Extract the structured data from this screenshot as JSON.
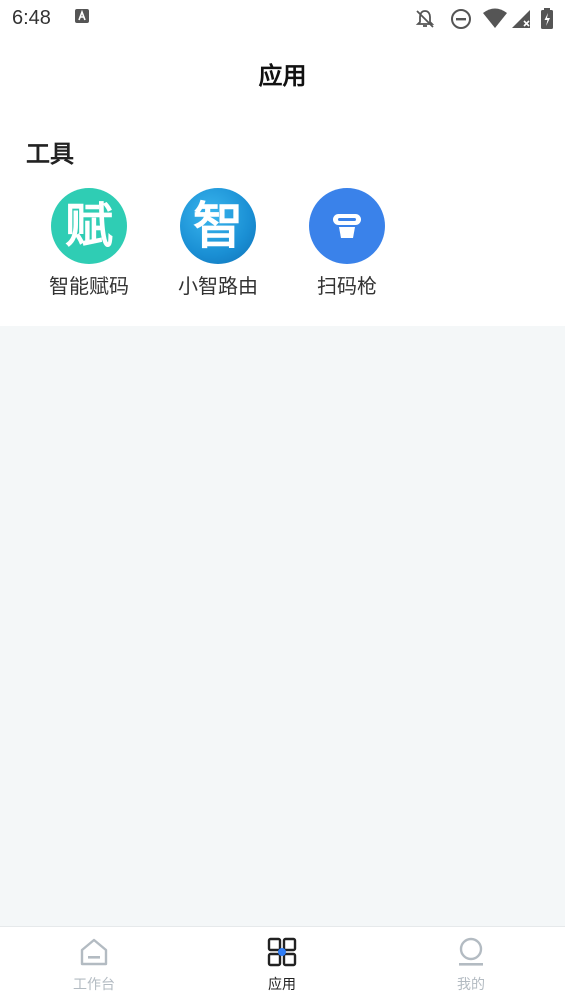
{
  "status_bar": {
    "time": "6:48"
  },
  "header": {
    "title": "应用"
  },
  "tools_section": {
    "title": "工具",
    "items": [
      {
        "label": "智能赋码",
        "icon_glyph": "赋",
        "icon": "fu-icon",
        "color": "#2fcdb4"
      },
      {
        "label": "小智路由",
        "icon_glyph": "智",
        "icon": "zhi-icon",
        "color": "#1a97d8"
      },
      {
        "label": "扫码枪",
        "icon": "scanner-icon",
        "color": "#3a82ea"
      }
    ]
  },
  "bottom_nav": {
    "items": [
      {
        "label": "工作台",
        "icon": "home-icon",
        "active": false
      },
      {
        "label": "应用",
        "icon": "apps-grid-icon",
        "active": true
      },
      {
        "label": "我的",
        "icon": "profile-icon",
        "active": false
      }
    ]
  },
  "colors": {
    "accent": "#2f7df6",
    "inactive": "#b3bbc2",
    "background": "#f4f7f8"
  }
}
